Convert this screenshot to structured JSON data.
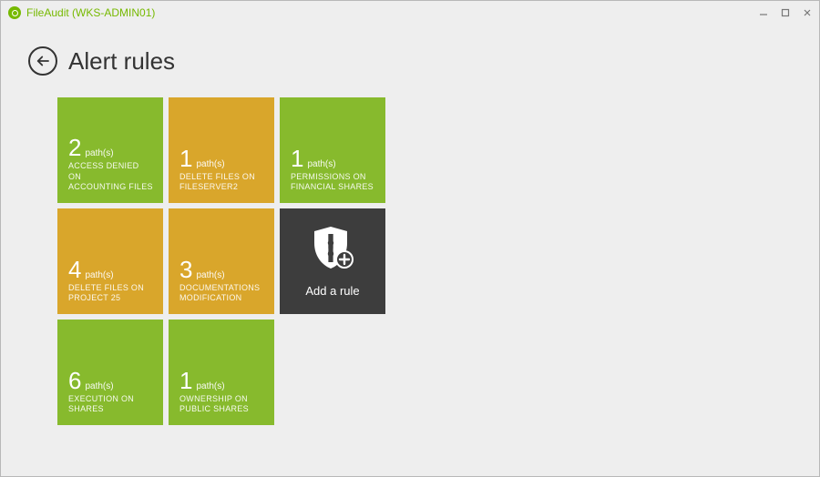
{
  "app": {
    "title": "FileAudit (WKS-ADMIN01)"
  },
  "page": {
    "title": "Alert rules"
  },
  "tiles": [
    {
      "count": "2",
      "paths_label": "path(s)",
      "label": "ACCESS DENIED ON\nACCOUNTING FILES",
      "color": "green"
    },
    {
      "count": "1",
      "paths_label": "path(s)",
      "label": "DELETE FILES ON\nFILESERVER2",
      "color": "orange"
    },
    {
      "count": "1",
      "paths_label": "path(s)",
      "label": "PERMISSIONS ON\nFINANCIAL SHARES",
      "color": "green"
    },
    {
      "count": "4",
      "paths_label": "path(s)",
      "label": "DELETE FILES ON\nPROJECT 25",
      "color": "orange"
    },
    {
      "count": "3",
      "paths_label": "path(s)",
      "label": "DOCUMENTATIONS\nMODIFICATION",
      "color": "orange"
    },
    {
      "count": "6",
      "paths_label": "path(s)",
      "label": "EXECUTION ON\nSHARES",
      "color": "green"
    },
    {
      "count": "1",
      "paths_label": "path(s)",
      "label": "OWNERSHIP ON\nPUBLIC SHARES",
      "color": "green"
    }
  ],
  "add_tile": {
    "label": "Add a rule"
  },
  "colors": {
    "green": "#87ba2d",
    "orange": "#d9a62b",
    "dark": "#3d3d3d",
    "accent": "#76b900"
  }
}
